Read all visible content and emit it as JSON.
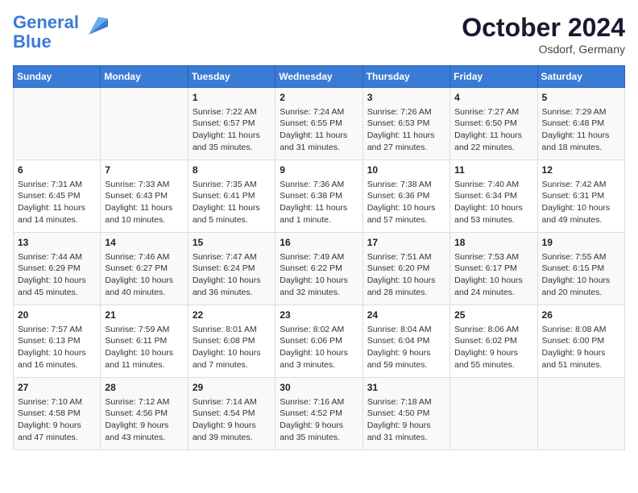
{
  "header": {
    "logo_line1": "General",
    "logo_line2": "Blue",
    "month_title": "October 2024",
    "location": "Osdorf, Germany"
  },
  "weekdays": [
    "Sunday",
    "Monday",
    "Tuesday",
    "Wednesday",
    "Thursday",
    "Friday",
    "Saturday"
  ],
  "weeks": [
    [
      {
        "day": "",
        "content": ""
      },
      {
        "day": "",
        "content": ""
      },
      {
        "day": "1",
        "content": "Sunrise: 7:22 AM\nSunset: 6:57 PM\nDaylight: 11 hours\nand 35 minutes."
      },
      {
        "day": "2",
        "content": "Sunrise: 7:24 AM\nSunset: 6:55 PM\nDaylight: 11 hours\nand 31 minutes."
      },
      {
        "day": "3",
        "content": "Sunrise: 7:26 AM\nSunset: 6:53 PM\nDaylight: 11 hours\nand 27 minutes."
      },
      {
        "day": "4",
        "content": "Sunrise: 7:27 AM\nSunset: 6:50 PM\nDaylight: 11 hours\nand 22 minutes."
      },
      {
        "day": "5",
        "content": "Sunrise: 7:29 AM\nSunset: 6:48 PM\nDaylight: 11 hours\nand 18 minutes."
      }
    ],
    [
      {
        "day": "6",
        "content": "Sunrise: 7:31 AM\nSunset: 6:45 PM\nDaylight: 11 hours\nand 14 minutes."
      },
      {
        "day": "7",
        "content": "Sunrise: 7:33 AM\nSunset: 6:43 PM\nDaylight: 11 hours\nand 10 minutes."
      },
      {
        "day": "8",
        "content": "Sunrise: 7:35 AM\nSunset: 6:41 PM\nDaylight: 11 hours\nand 5 minutes."
      },
      {
        "day": "9",
        "content": "Sunrise: 7:36 AM\nSunset: 6:38 PM\nDaylight: 11 hours\nand 1 minute."
      },
      {
        "day": "10",
        "content": "Sunrise: 7:38 AM\nSunset: 6:36 PM\nDaylight: 10 hours\nand 57 minutes."
      },
      {
        "day": "11",
        "content": "Sunrise: 7:40 AM\nSunset: 6:34 PM\nDaylight: 10 hours\nand 53 minutes."
      },
      {
        "day": "12",
        "content": "Sunrise: 7:42 AM\nSunset: 6:31 PM\nDaylight: 10 hours\nand 49 minutes."
      }
    ],
    [
      {
        "day": "13",
        "content": "Sunrise: 7:44 AM\nSunset: 6:29 PM\nDaylight: 10 hours\nand 45 minutes."
      },
      {
        "day": "14",
        "content": "Sunrise: 7:46 AM\nSunset: 6:27 PM\nDaylight: 10 hours\nand 40 minutes."
      },
      {
        "day": "15",
        "content": "Sunrise: 7:47 AM\nSunset: 6:24 PM\nDaylight: 10 hours\nand 36 minutes."
      },
      {
        "day": "16",
        "content": "Sunrise: 7:49 AM\nSunset: 6:22 PM\nDaylight: 10 hours\nand 32 minutes."
      },
      {
        "day": "17",
        "content": "Sunrise: 7:51 AM\nSunset: 6:20 PM\nDaylight: 10 hours\nand 28 minutes."
      },
      {
        "day": "18",
        "content": "Sunrise: 7:53 AM\nSunset: 6:17 PM\nDaylight: 10 hours\nand 24 minutes."
      },
      {
        "day": "19",
        "content": "Sunrise: 7:55 AM\nSunset: 6:15 PM\nDaylight: 10 hours\nand 20 minutes."
      }
    ],
    [
      {
        "day": "20",
        "content": "Sunrise: 7:57 AM\nSunset: 6:13 PM\nDaylight: 10 hours\nand 16 minutes."
      },
      {
        "day": "21",
        "content": "Sunrise: 7:59 AM\nSunset: 6:11 PM\nDaylight: 10 hours\nand 11 minutes."
      },
      {
        "day": "22",
        "content": "Sunrise: 8:01 AM\nSunset: 6:08 PM\nDaylight: 10 hours\nand 7 minutes."
      },
      {
        "day": "23",
        "content": "Sunrise: 8:02 AM\nSunset: 6:06 PM\nDaylight: 10 hours\nand 3 minutes."
      },
      {
        "day": "24",
        "content": "Sunrise: 8:04 AM\nSunset: 6:04 PM\nDaylight: 9 hours\nand 59 minutes."
      },
      {
        "day": "25",
        "content": "Sunrise: 8:06 AM\nSunset: 6:02 PM\nDaylight: 9 hours\nand 55 minutes."
      },
      {
        "day": "26",
        "content": "Sunrise: 8:08 AM\nSunset: 6:00 PM\nDaylight: 9 hours\nand 51 minutes."
      }
    ],
    [
      {
        "day": "27",
        "content": "Sunrise: 7:10 AM\nSunset: 4:58 PM\nDaylight: 9 hours\nand 47 minutes."
      },
      {
        "day": "28",
        "content": "Sunrise: 7:12 AM\nSunset: 4:56 PM\nDaylight: 9 hours\nand 43 minutes."
      },
      {
        "day": "29",
        "content": "Sunrise: 7:14 AM\nSunset: 4:54 PM\nDaylight: 9 hours\nand 39 minutes."
      },
      {
        "day": "30",
        "content": "Sunrise: 7:16 AM\nSunset: 4:52 PM\nDaylight: 9 hours\nand 35 minutes."
      },
      {
        "day": "31",
        "content": "Sunrise: 7:18 AM\nSunset: 4:50 PM\nDaylight: 9 hours\nand 31 minutes."
      },
      {
        "day": "",
        "content": ""
      },
      {
        "day": "",
        "content": ""
      }
    ]
  ]
}
